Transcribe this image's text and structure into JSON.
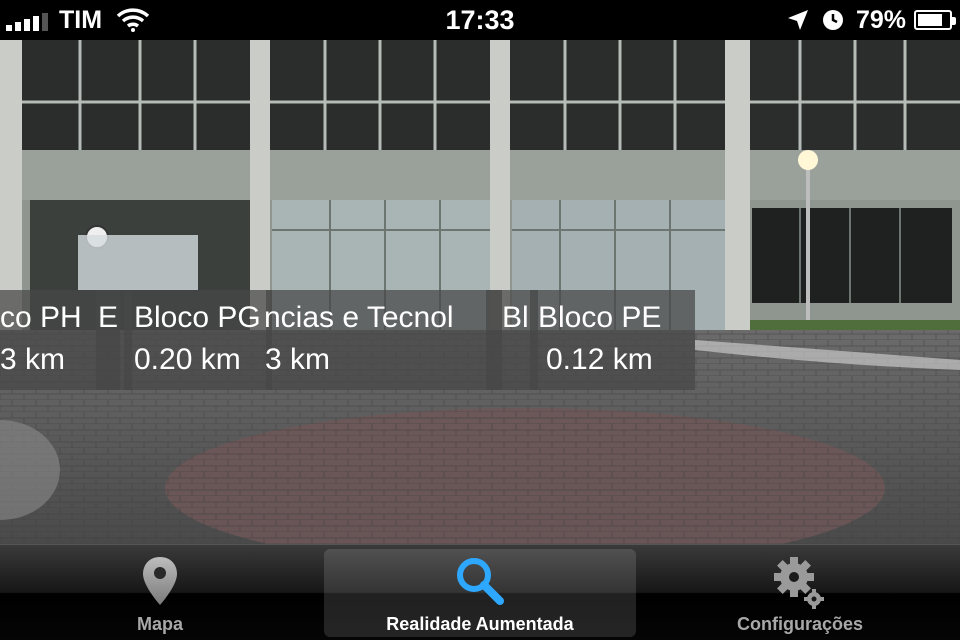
{
  "status_bar": {
    "carrier": "TIM",
    "time": "17:33",
    "battery_percent": "79%",
    "battery_level": 0.79,
    "signal_bars": 4,
    "icons": [
      "wifi-icon",
      "location-arrow-icon",
      "alarm-clock-icon",
      "battery-icon"
    ]
  },
  "ar_labels": [
    {
      "name": "co PH",
      "distance": "3 km"
    },
    {
      "name": "E",
      "distance": ""
    },
    {
      "name": "Bloco PG",
      "distance": "0.20 km"
    },
    {
      "name": "ncias e Tecnol",
      "distance": "3 km"
    },
    {
      "name": "Bl",
      "distance": ""
    },
    {
      "name": "Bloco PE",
      "distance": "0.12 km"
    }
  ],
  "tab_bar": {
    "tabs": [
      {
        "label": "Mapa",
        "icon": "map-pin-icon",
        "selected": false
      },
      {
        "label": "Realidade Aumentada",
        "icon": "search-icon",
        "selected": true
      },
      {
        "label": "Configurações",
        "icon": "gear-icon",
        "selected": false
      }
    ]
  },
  "colors": {
    "accent_blue": "#2ea8ff",
    "label_background": "#464646"
  }
}
